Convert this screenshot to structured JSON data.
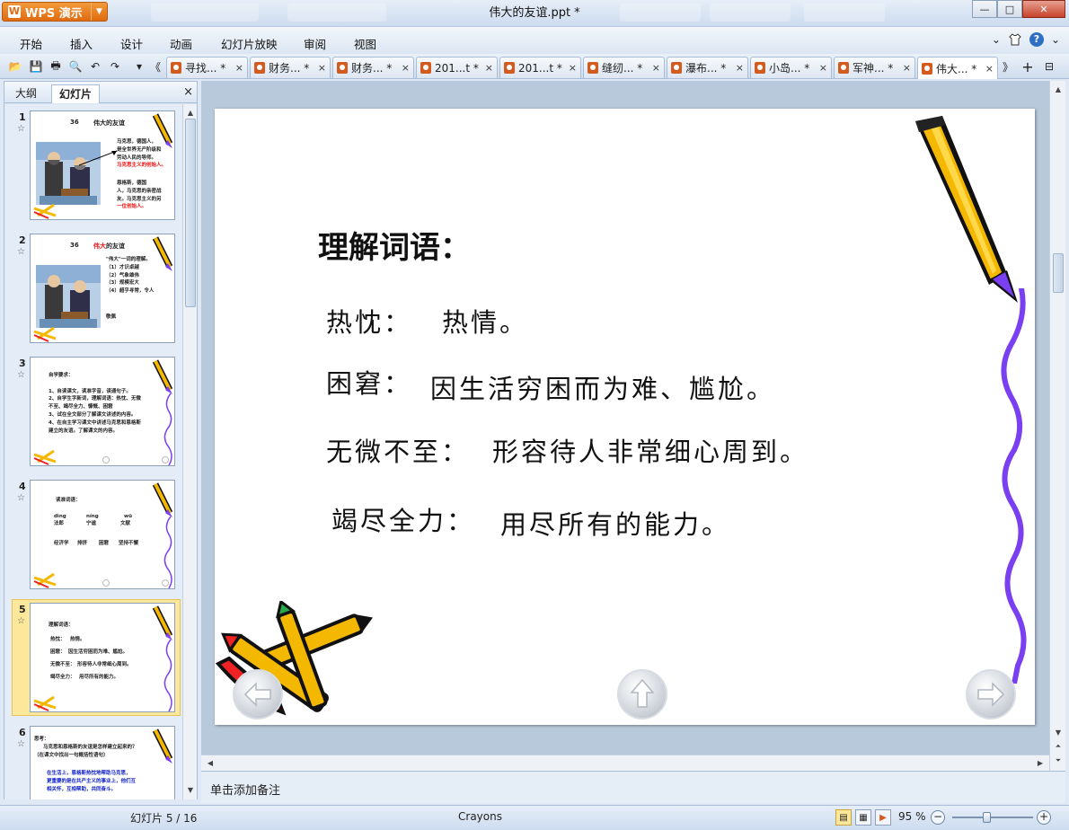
{
  "app": {
    "name": "WPS 演示",
    "logo": "W",
    "window_title": "伟大的友谊.ppt *",
    "minimize_symbol": "—",
    "maximize_symbol": "□",
    "close_symbol": "✕"
  },
  "menu": {
    "items": [
      "开始",
      "插入",
      "设计",
      "动画",
      "幻灯片放映",
      "审阅",
      "视图"
    ],
    "right_caret": "⌄",
    "help": "?"
  },
  "toolbar": {
    "icons": [
      "open-folder-icon",
      "save-icon",
      "print-icon",
      "print-preview-icon",
      "undo-icon",
      "redo-icon"
    ],
    "glyphs": [
      "📂",
      "💾",
      "🖶",
      "🔍",
      "↶",
      "↷"
    ],
    "more": "▾",
    "scroll_left": "《",
    "scroll_right": "》",
    "new_tab": "+",
    "window_menu": "⊟"
  },
  "doc_tabs": [
    {
      "label": "寻找... *",
      "active": false
    },
    {
      "label": "财务... *",
      "active": false
    },
    {
      "label": "财务... *",
      "active": false
    },
    {
      "label": "201...t *",
      "active": false
    },
    {
      "label": "201...t *",
      "active": false
    },
    {
      "label": "缝纫... *",
      "active": false
    },
    {
      "label": "瀑布... *",
      "active": false
    },
    {
      "label": "小岛... *",
      "active": false
    },
    {
      "label": "军神... *",
      "active": false
    },
    {
      "label": "伟大... *",
      "active": true
    }
  ],
  "left_panel": {
    "tab_outline": "大纲",
    "tab_slides": "幻灯片",
    "close": "×",
    "scroll_up": "▲",
    "scroll_down": "▼",
    "slides": [
      {
        "num": "1",
        "star": "☆",
        "title_num": "36",
        "title": "伟大的友谊",
        "lines": [
          "马克思，德国人，",
          "是全世界无产阶级和",
          "劳动人民的导师。",
          "马克思主义的创始人。",
          "恩格斯，德国",
          "人，马克思的亲密战",
          "友。马克思主义的另",
          "一位创始人。"
        ]
      },
      {
        "num": "2",
        "star": "☆",
        "title_num": "36",
        "title_pre": "伟大",
        "title_post": "的友谊",
        "lines": [
          "\"伟大\"一词的理解。",
          "（1）才识卓越",
          "（2）气象雄伟",
          "（3）规模宏大",
          "（4）超乎寻常，令人",
          "敬佩"
        ]
      },
      {
        "num": "3",
        "star": "☆",
        "lines": [
          "自学要求：",
          "1、自读课文，读准字音，读通句子。",
          "2、自学生字新词，理解词语：热忱、无微",
          "不至、竭尽全力、慷慨、困窘",
          "3、试在全文部分了解课文讲述的内容。",
          "4、在自主学习课文中讲述马克思和恩格斯",
          "建立的友谊。了解课文的内容。"
        ]
      },
      {
        "num": "4",
        "star": "☆",
        "lines": [
          "读准词语：",
          "dìng",
          "níng",
          "wū",
          "法郎",
          "宁谧",
          "文献",
          "经济学",
          "排挤",
          "困窘",
          "坚持不懈"
        ]
      },
      {
        "num": "5",
        "star": "☆",
        "selected": true,
        "lines": [
          "理解词语：",
          "热忱：",
          "热情。",
          "困窘：",
          "因生活穷困而为难、尴尬。",
          "无微不至：",
          "形容待人非常细心周到。",
          "竭尽全力：",
          "用尽所有的能力。"
        ]
      },
      {
        "num": "6",
        "star": "☆",
        "lines": [
          "思考：",
          "马克思和恩格斯的友谊是怎样建立起来的？",
          "（在课文中找出一句概括性语句）",
          "在生活上，恩格斯热忱地帮助马克思，",
          "更重要的是在共产主义的事业上，他们互",
          "相关怀，互相帮助，共同奋斗。"
        ]
      }
    ]
  },
  "slide": {
    "title": "理解词语：",
    "lines": [
      {
        "term": "热忱：",
        "meaning": "热情。"
      },
      {
        "term": "困窘：",
        "meaning": "因生活穷困而为难、尴尬。"
      },
      {
        "term": "无微不至：",
        "meaning": "形容待人非常细心周到。"
      },
      {
        "term": "竭尽全力：",
        "meaning": "用尽所有的能力。"
      }
    ]
  },
  "scroll": {
    "up": "▲",
    "down": "▼",
    "left": "◀",
    "right": "▶",
    "prev_page": "⏶",
    "next_page": "⏷"
  },
  "notes_placeholder": "单击添加备注",
  "status": {
    "slide_counter": "幻灯片 5 / 16",
    "theme": "Crayons",
    "zoom": "95 %",
    "zoom_out": "−",
    "zoom_in": "+",
    "zoom_level": 0.42
  },
  "colors": {
    "wps_orange": "#e06b10",
    "selection": "#fde79a",
    "pencil_yellow": "#f5b800",
    "squiggle_purple": "#7a3ff0"
  }
}
